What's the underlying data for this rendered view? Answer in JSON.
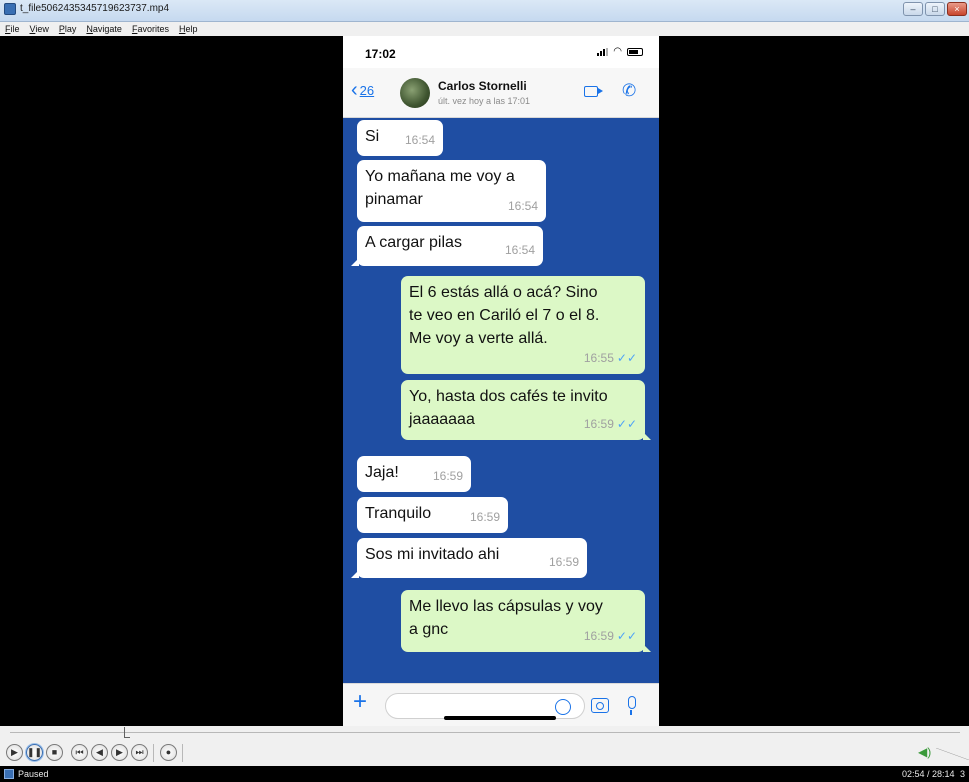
{
  "window": {
    "title": "t_file5062435345719623737.mp4"
  },
  "menu": [
    "File",
    "View",
    "Play",
    "Navigate",
    "Favorites",
    "Help"
  ],
  "phone": {
    "time": "17:02",
    "header": {
      "back_count": "26",
      "contact_name": "Carlos Stornelli",
      "last_seen": "últ. vez hoy a las 17:01"
    },
    "messages": [
      {
        "dir": "in",
        "text": "Si",
        "time": "16:54"
      },
      {
        "dir": "in",
        "text": "Yo mañana me voy a\npinamar",
        "time": "16:54"
      },
      {
        "dir": "in",
        "text": "A cargar pilas",
        "time": "16:54"
      },
      {
        "dir": "out",
        "text": "El 6 estás allá o acá? Sino\nte veo en Cariló el 7 o el 8.\nMe voy a verte allá.",
        "time": "16:55"
      },
      {
        "dir": "out",
        "text": "Yo, hasta dos cafés te invito\njaaaaaaa",
        "time": "16:59"
      },
      {
        "dir": "in",
        "text": "Jaja!",
        "time": "16:59"
      },
      {
        "dir": "in",
        "text": "Tranquilo",
        "time": "16:59"
      },
      {
        "dir": "in",
        "text": "Sos mi invitado ahi",
        "time": "16:59"
      },
      {
        "dir": "out",
        "text": "Me llevo las cápsulas y voy\na gnc",
        "time": "16:59"
      }
    ],
    "colors": {
      "chat_background": "#1f4ea3",
      "outgoing_bubble": "#dcf8c6",
      "accent": "#1a73e8"
    }
  },
  "player": {
    "seek_position": 0.12,
    "controls": [
      "play-button",
      "pause-button",
      "stop-button",
      "previous-button",
      "rewind-button",
      "fast-forward-button",
      "next-button",
      "open-file-button"
    ],
    "status": "Paused",
    "time_readout": "02:54 / 28:14",
    "status_extra": "3"
  }
}
